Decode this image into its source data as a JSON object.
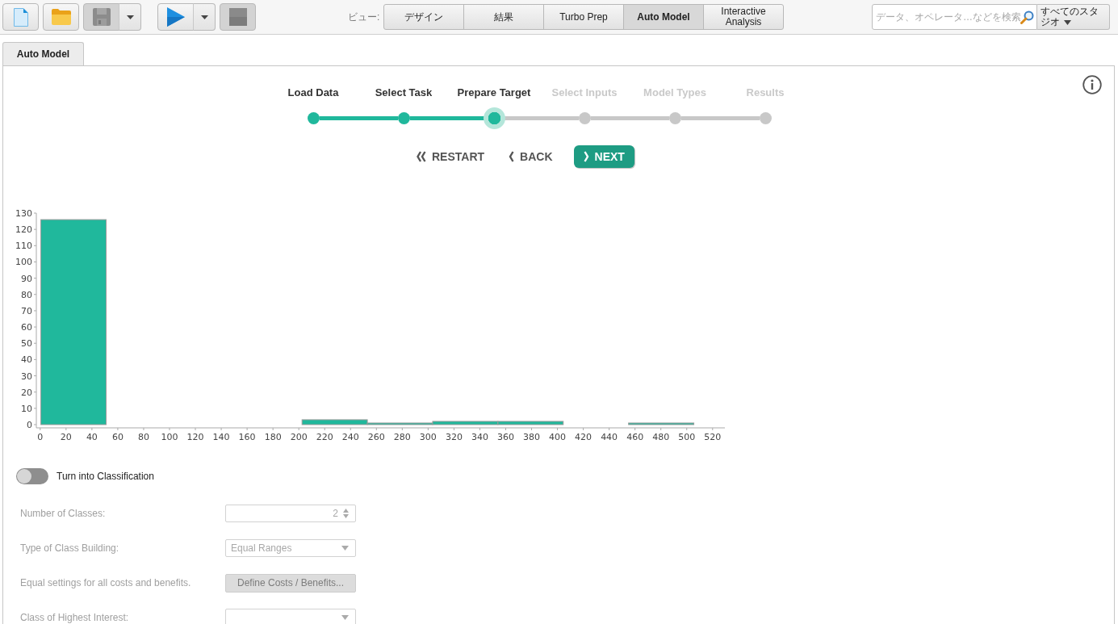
{
  "toolbar": {
    "groups": [
      {
        "buttons": [
          {
            "kind": "new",
            "disabled": false,
            "menu": false
          },
          {
            "kind": "open",
            "disabled": false,
            "menu": false
          },
          {
            "kind": "save",
            "disabled": true,
            "menu": true
          }
        ]
      },
      {
        "buttons": [
          {
            "kind": "run",
            "disabled": false,
            "menu": true
          },
          {
            "kind": "stop",
            "disabled": true,
            "menu": false
          }
        ]
      }
    ]
  },
  "view_switcher": {
    "label": "ビュー:",
    "views": [
      {
        "label": "デザイン",
        "selected": false
      },
      {
        "label": "結果",
        "selected": false
      },
      {
        "label": "Turbo Prep",
        "selected": false
      },
      {
        "label": "Auto Model",
        "selected": true
      },
      {
        "label": "Interactive Analysis",
        "selected": false
      }
    ]
  },
  "search": {
    "placeholder": "データ、オペレータ…などを検索"
  },
  "studio_menu": {
    "label": "すべてのスタジオ"
  },
  "tabs": [
    {
      "label": "Auto Model",
      "selected": true
    }
  ],
  "wizard": {
    "steps": [
      {
        "label": "Load Data",
        "reached": true,
        "current": false
      },
      {
        "label": "Select Task",
        "reached": true,
        "current": false
      },
      {
        "label": "Prepare Target",
        "reached": true,
        "current": true
      },
      {
        "label": "Select Inputs",
        "reached": false,
        "current": false
      },
      {
        "label": "Model Types",
        "reached": false,
        "current": false
      },
      {
        "label": "Results",
        "reached": false,
        "current": false
      }
    ],
    "buttons": [
      {
        "kind": "restart",
        "label": "RESTART",
        "primary": false
      },
      {
        "kind": "back",
        "label": "BACK",
        "primary": false
      },
      {
        "kind": "next",
        "label": "NEXT",
        "primary": true
      }
    ]
  },
  "histogram": {
    "chart_data": {
      "type": "bar",
      "x": [
        25.75,
        227.75,
        278.25,
        328.75,
        379.25,
        480.25
      ],
      "values": [
        126,
        3,
        1,
        2,
        2,
        1
      ],
      "xlim": [
        -3,
        529.5
      ],
      "ylim": [
        0,
        130
      ],
      "xticks": [
        0,
        20,
        40,
        60,
        80,
        100,
        120,
        140,
        160,
        180,
        200,
        220,
        240,
        260,
        280,
        300,
        320,
        340,
        360,
        380,
        400,
        420,
        440,
        460,
        480,
        500,
        520
      ],
      "yticks": [
        0,
        10,
        20,
        30,
        40,
        50,
        60,
        70,
        80,
        90,
        100,
        110,
        120,
        130
      ]
    }
  },
  "classification": {
    "toggle": {
      "label": "Turn into Classification",
      "on": false
    },
    "fields": [
      {
        "kind": "spinner",
        "label": "Number of Classes:",
        "value": "2",
        "disabled": true
      },
      {
        "kind": "dropdown",
        "label": "Type of Class Building:",
        "value": "Equal Ranges",
        "disabled": true
      },
      {
        "kind": "button",
        "label": "Equal settings for all costs and benefits.",
        "button_label": "Define Costs / Benefits...",
        "disabled": true
      },
      {
        "kind": "dropdown",
        "label": "Class of Highest Interest:",
        "disabled": true
      }
    ]
  }
}
